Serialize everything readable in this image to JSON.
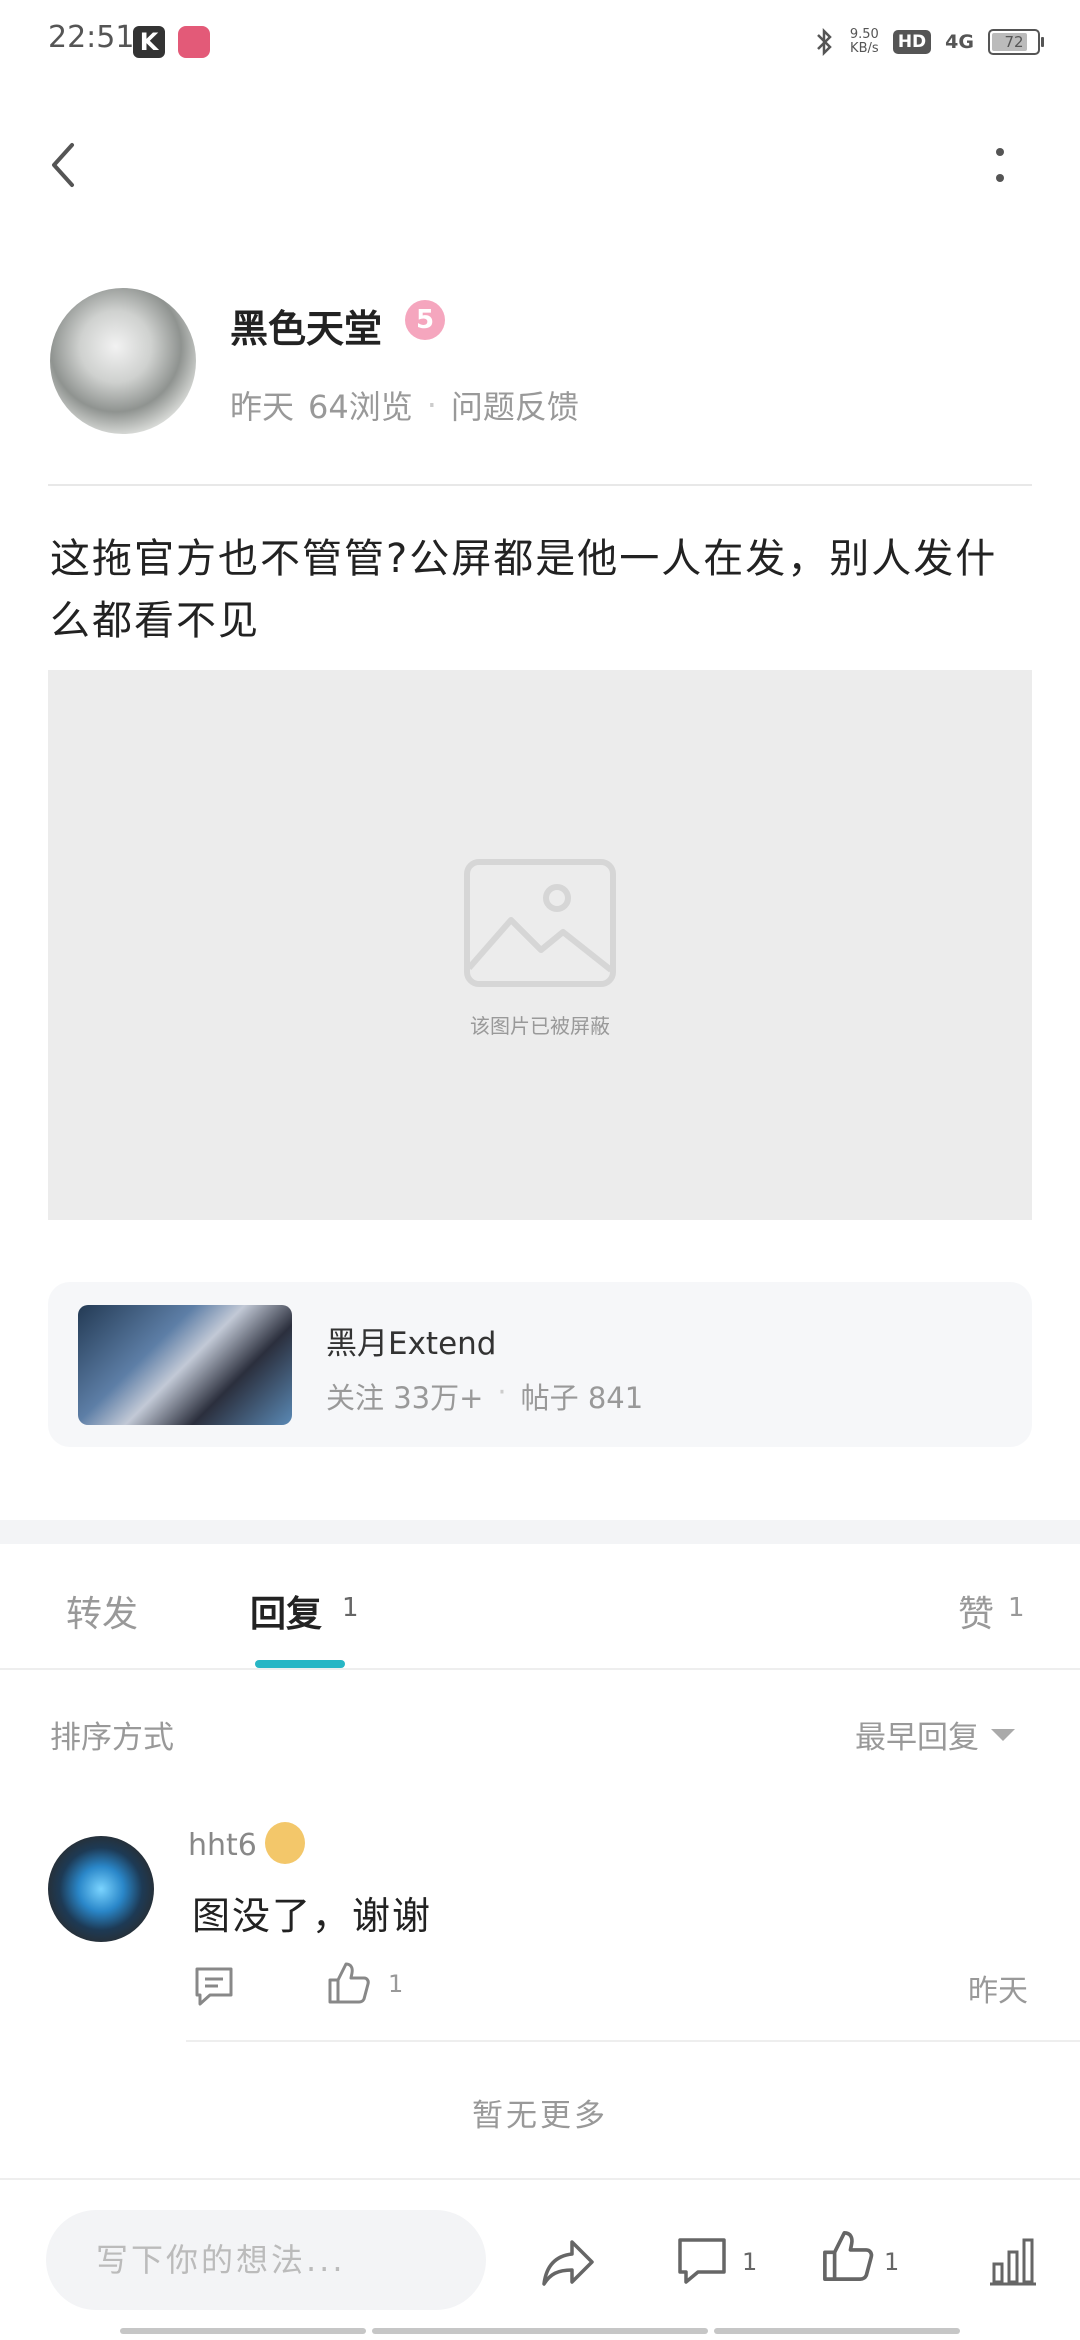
{
  "status_bar": {
    "time": "22:51",
    "k_label": "K",
    "net_speed_value": "9.50",
    "net_speed_unit": "KB/s",
    "hd_label": "HD",
    "signal_label": "4G",
    "battery": "72",
    "battery_level": 0.72
  },
  "icons": {
    "back": "chevron-left-icon",
    "more": "more-vertical-icon",
    "share": "share-arrow-icon",
    "comment": "comment-bubble-icon",
    "like": "thumbs-up-icon",
    "stats": "bar-chart-icon"
  },
  "post": {
    "author": "黑色天堂",
    "level": "5",
    "time": "昨天",
    "views": "64浏览",
    "category": "问题反馈",
    "text": "这拖官方也不管管?公屏都是他一人在发，别人发什么都看不见",
    "blocked_image_label": "该图片已被屏蔽"
  },
  "board": {
    "name": "黑月Extend",
    "followers": "关注 33万+",
    "posts": "帖子 841"
  },
  "tabs": {
    "forward": "转发",
    "reply": "回复",
    "reply_count": "1",
    "like": "赞",
    "like_count": "1",
    "accent_color": "#27b6c5"
  },
  "sort": {
    "label": "排序方式",
    "selected": "最早回复"
  },
  "comment": {
    "author": "hht6",
    "text": "图没了，谢谢",
    "like_count": "1",
    "time": "昨天"
  },
  "no_more": "暂无更多",
  "bottom_bar": {
    "input_placeholder": "写下你的想法...",
    "comment_count": "1",
    "like_count": "1"
  }
}
